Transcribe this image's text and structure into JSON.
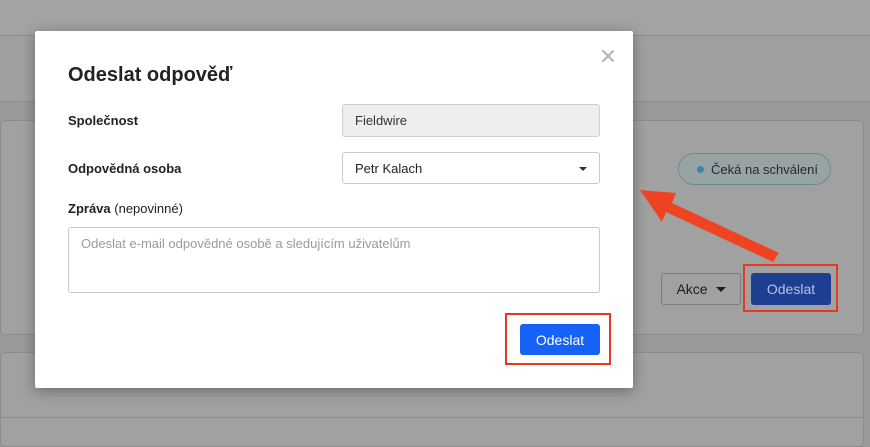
{
  "background": {
    "status_badge": "Čeká na schválení",
    "actions_button": "Akce",
    "send_button": "Odeslat"
  },
  "modal": {
    "title": "Odeslat odpověď",
    "company": {
      "label": "Společnost",
      "value": "Fieldwire"
    },
    "responsible_person": {
      "label": "Odpovědná osoba",
      "value": "Petr Kalach"
    },
    "message": {
      "label": "Zpráva",
      "optional_note": "(nepovinné)",
      "placeholder": "Odeslat e-mail odpovědné osobě a sledujícím uživatelům",
      "value": ""
    },
    "send_button": "Odeslat"
  },
  "annotations": {
    "highlight_color": "#e8391d",
    "primary_color": "#1662f7"
  }
}
